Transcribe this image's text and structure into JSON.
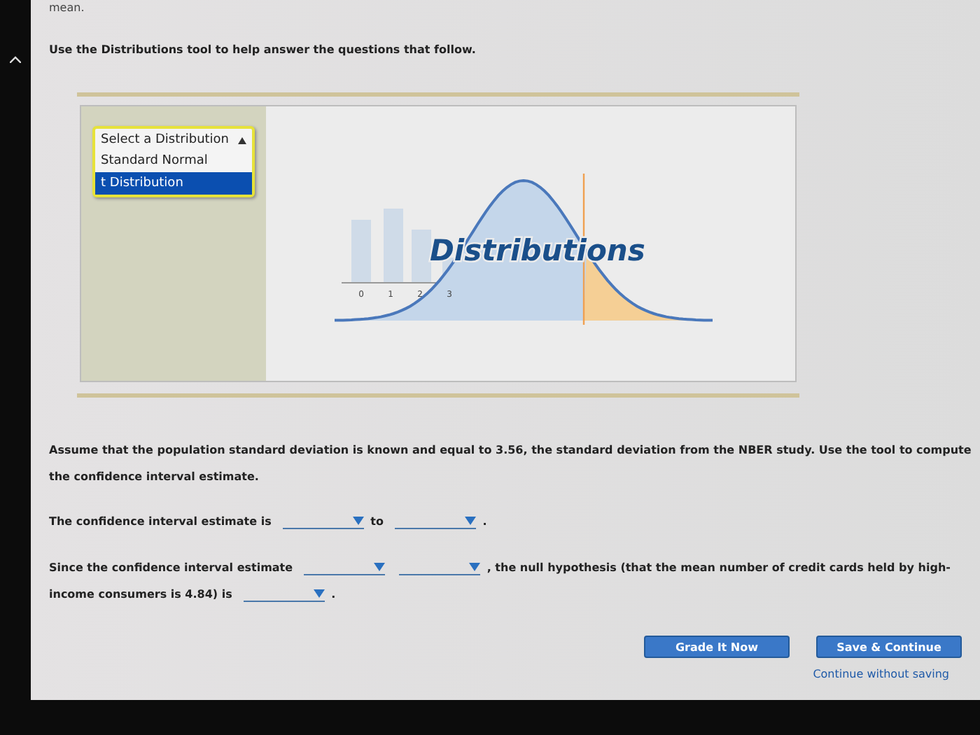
{
  "top_text": "mean.",
  "intro": "Use the Distributions tool to help answer the questions that follow.",
  "tool": {
    "menu": {
      "header": "Select a Distribution",
      "options": [
        {
          "label": "Standard Normal",
          "selected": false
        },
        {
          "label": "t Distribution",
          "selected": true
        }
      ]
    },
    "logo": {
      "title": "Distributions",
      "ticks": [
        "0",
        "1",
        "2",
        "3"
      ]
    }
  },
  "question": "Assume that the population standard deviation is known and equal to 3.56, the standard deviation from the NBER study. Use the tool to compute the confidence interval estimate.",
  "sentences": [
    {
      "parts": [
        {
          "kind": "text",
          "text": "The confidence interval estimate is"
        },
        {
          "kind": "dropdown"
        },
        {
          "kind": "text",
          "text": "to"
        },
        {
          "kind": "dropdown"
        },
        {
          "kind": "text",
          "text": "."
        }
      ]
    },
    {
      "parts": [
        {
          "kind": "text",
          "text": "Since the confidence interval estimate"
        },
        {
          "kind": "dropdown"
        },
        {
          "kind": "dropdown"
        },
        {
          "kind": "text",
          "text": ", the null hypothesis (that the mean number of credit cards held by high-"
        },
        {
          "kind": "text",
          "text": "income consumers is 4.84) is"
        },
        {
          "kind": "dropdown"
        },
        {
          "kind": "text",
          "text": "."
        }
      ]
    }
  ],
  "buttons": [
    "Grade It Now",
    "Save & Continue"
  ],
  "link": "Continue without saving"
}
